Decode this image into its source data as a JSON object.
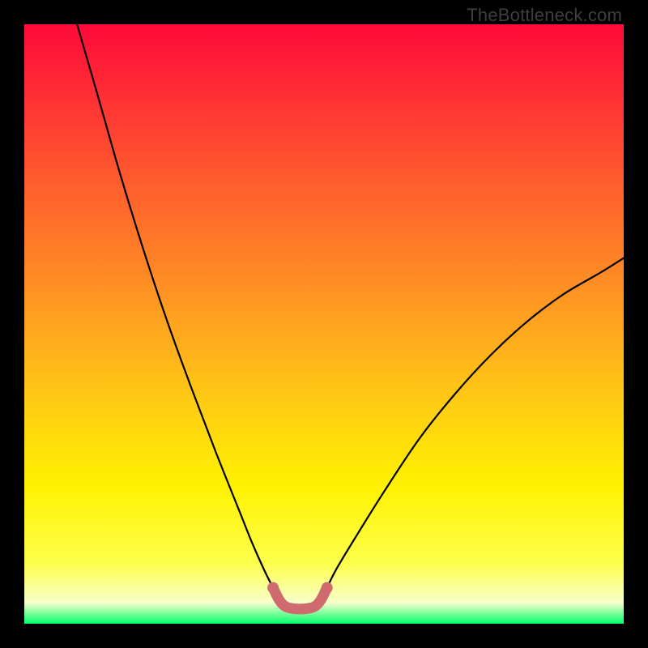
{
  "watermark": "TheBottleneck.com",
  "chart_data": {
    "type": "line",
    "title": "",
    "xlabel": "",
    "ylabel": "",
    "xlim": [
      0,
      100
    ],
    "ylim": [
      0,
      100
    ],
    "grid": false,
    "legend": false,
    "series": [
      {
        "name": "left-branch",
        "color": "#000000",
        "x": [
          8.8,
          12,
          16,
          20,
          24,
          28,
          32,
          36,
          38,
          40,
          41.5
        ],
        "y": [
          100,
          89,
          75,
          62,
          50,
          39,
          28.5,
          18.5,
          13.5,
          9,
          6
        ]
      },
      {
        "name": "right-branch",
        "color": "#000000",
        "x": [
          50.5,
          52,
          55,
          60,
          66,
          72,
          78,
          84,
          90,
          96,
          100
        ],
        "y": [
          6,
          9,
          14,
          22,
          31,
          38.5,
          45,
          50.5,
          55,
          58.5,
          61
        ]
      },
      {
        "name": "valley-marker",
        "color": "#cf6a6f",
        "x": [
          41.5,
          42.5,
          43.5,
          45,
          47,
          48.5,
          49.5,
          50.5
        ],
        "y": [
          6,
          4,
          2.9,
          2.5,
          2.5,
          2.9,
          4,
          6
        ]
      }
    ],
    "background_gradient_colors": [
      "#ff0a3a",
      "#ff2f34",
      "#ff582e",
      "#ff7e27",
      "#ffa41f",
      "#ffcb14",
      "#fff200",
      "#fdff4d",
      "#f8ffcc",
      "#00ff6a"
    ]
  }
}
